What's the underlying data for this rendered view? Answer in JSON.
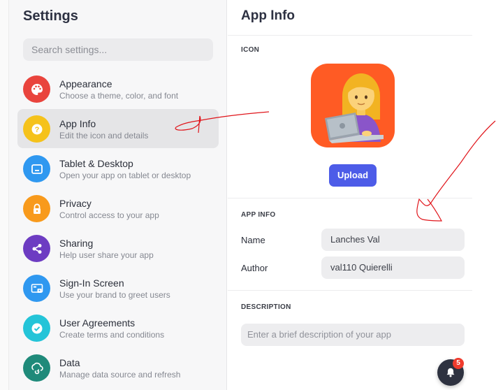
{
  "sidebar": {
    "title": "Settings",
    "search_placeholder": "Search settings...",
    "items": [
      {
        "title": "Appearance",
        "subtitle": "Choose a theme, color, and font",
        "icon": "palette-icon",
        "color": "#e9443d"
      },
      {
        "title": "App Info",
        "subtitle": "Edit the icon and details",
        "icon": "question-icon",
        "color": "#f5c21b",
        "active": true
      },
      {
        "title": "Tablet & Desktop",
        "subtitle": "Open your app on tablet or desktop",
        "icon": "tablet-icon",
        "color": "#2f98f0"
      },
      {
        "title": "Privacy",
        "subtitle": "Control access to your app",
        "icon": "lock-icon",
        "color": "#f89a1c"
      },
      {
        "title": "Sharing",
        "subtitle": "Help user share your app",
        "icon": "share-icon",
        "color": "#6d3cc2"
      },
      {
        "title": "Sign-In Screen",
        "subtitle": "Use your brand to greet users",
        "icon": "signin-screen-icon",
        "color": "#2f98f0"
      },
      {
        "title": "User Agreements",
        "subtitle": "Create terms and conditions",
        "icon": "check-icon",
        "color": "#24c4d8"
      },
      {
        "title": "Data",
        "subtitle": "Manage data source and refresh",
        "icon": "data-refresh-icon",
        "color": "#1f8a7a"
      }
    ]
  },
  "main": {
    "title": "App Info",
    "icon_section_label": "ICON",
    "app_icon": "woman-technologist-icon",
    "upload_label": "Upload",
    "app_info_label": "APP INFO",
    "name_label": "Name",
    "name_value": "Lanches Val",
    "author_label": "Author",
    "author_value": "val110 Quierelli",
    "description_label": "DESCRIPTION",
    "description_placeholder": "Enter a brief description of your app"
  },
  "notifications": {
    "icon": "bell-icon",
    "count": "5"
  },
  "colors": {
    "accent": "#4d5ce8",
    "app_icon_bg": "#ff5b24",
    "badge": "#ef3b2d",
    "annotation": "#e0141a"
  }
}
